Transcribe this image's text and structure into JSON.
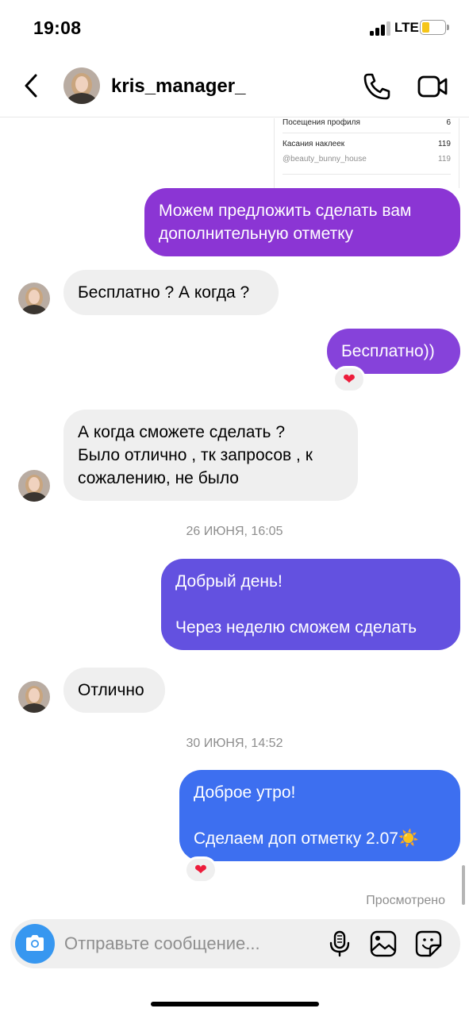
{
  "status_bar": {
    "time": "19:08",
    "network": "LTE",
    "signal_bars_active": 3,
    "signal_bars_total": 4,
    "battery_level": 0.35,
    "battery_color": "#f5c518"
  },
  "header": {
    "username": "kris_manager_",
    "icons": [
      "back-icon",
      "avatar",
      "phone-icon",
      "video-camera-icon"
    ]
  },
  "shared_card": {
    "rows": [
      {
        "label": "Посещения профиля",
        "value": "6"
      },
      {
        "label": "Касания наклеек",
        "value": "119"
      },
      {
        "label": "@beauty_bunny_house",
        "value": "119"
      }
    ]
  },
  "messages": [
    {
      "direction": "out",
      "color": "#8b35d4",
      "lines": [
        "Можем предложить сделать вам",
        "дополнительную отметку"
      ]
    },
    {
      "direction": "in",
      "lines": [
        "Бесплатно ? А когда ?"
      ]
    },
    {
      "direction": "out",
      "color": "#8642da",
      "lines": [
        "Бесплатно))"
      ],
      "reaction": "❤"
    },
    {
      "direction": "in",
      "lines": [
        "А когда сможете сделать ?",
        "Было отлично , тк запросов , к",
        "сожалению, не было"
      ]
    },
    {
      "direction": "out",
      "color": "#6351e0",
      "lines": [
        "Добрый день!",
        "",
        "Через неделю сможем сделать"
      ]
    },
    {
      "direction": "in",
      "lines": [
        "Отлично"
      ]
    },
    {
      "direction": "out",
      "color": "#3d6ff0",
      "lines": [
        "Доброе утро!",
        "",
        "Сделаем доп отметку 2.07☀️"
      ],
      "reaction": "❤"
    }
  ],
  "timestamps": [
    "26 ИЮНЯ, 16:05",
    "30 ИЮНЯ, 14:52"
  ],
  "seen_label": "Просмотрено",
  "composer": {
    "placeholder": "Отправьте сообщение...",
    "accent_color": "#3797f0",
    "icons": [
      "camera-icon",
      "microphone-icon",
      "gallery-icon",
      "sticker-icon"
    ]
  }
}
